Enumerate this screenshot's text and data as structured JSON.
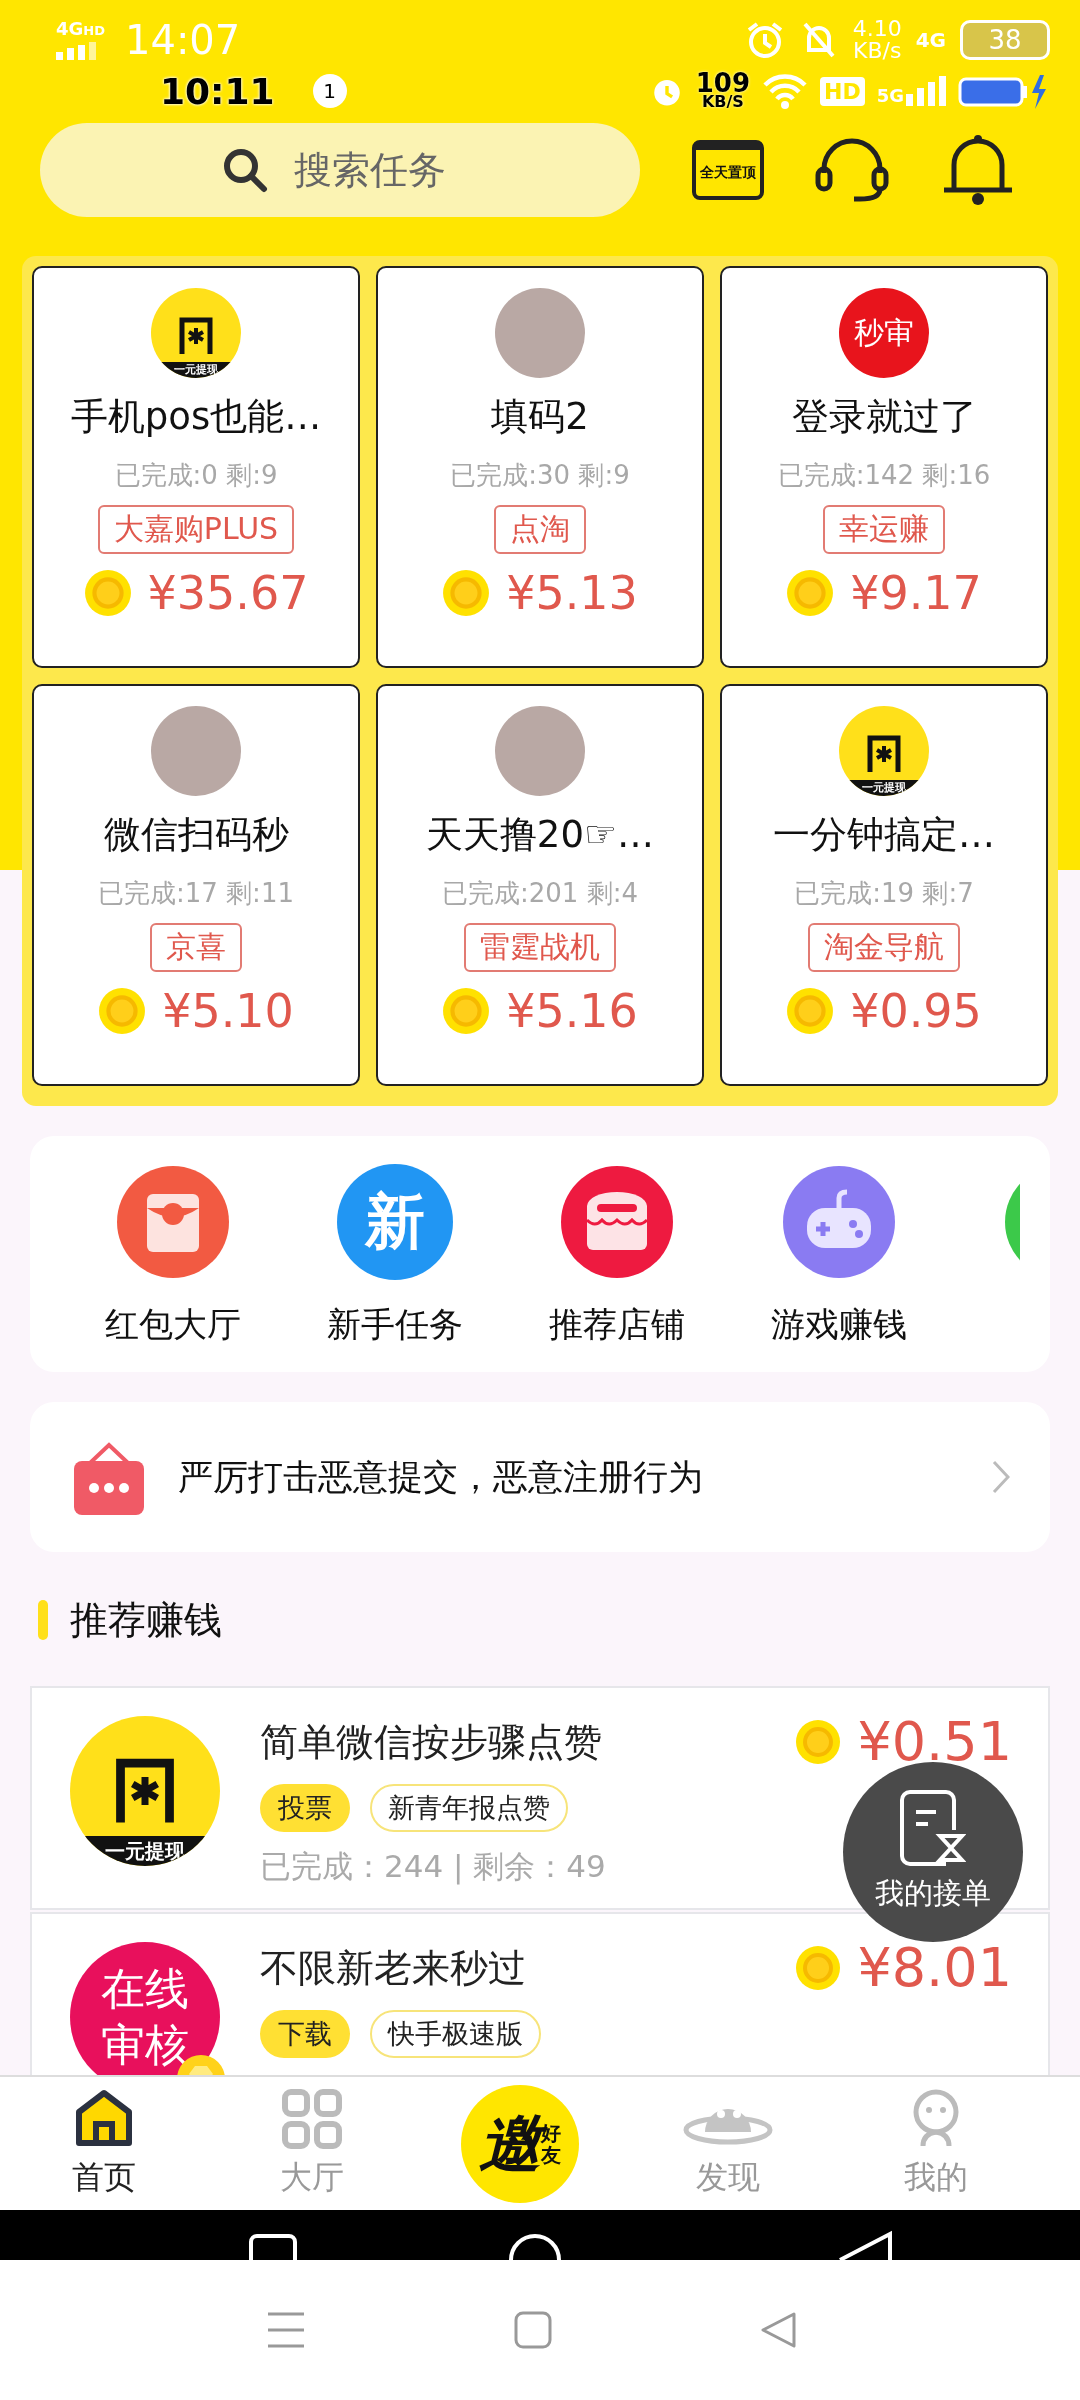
{
  "status_bar_back": {
    "network": "4G",
    "network_hd": "HD",
    "time": "14:07",
    "speed": "4.10",
    "speed_unit": "KB/s",
    "network_right": "4G",
    "battery": "38"
  },
  "status_bar": {
    "time": "10:11",
    "notifications": "1",
    "speed": "109",
    "speed_unit": "KB/S",
    "hd": "HD",
    "network": "5G"
  },
  "search": {
    "placeholder": "搜索任务"
  },
  "pin_button": {
    "label": "全天置顶"
  },
  "featured_tasks": [
    {
      "kind": "logo",
      "avatar_text": "一元提现",
      "title": "手机pos也能…",
      "stats": "已完成:0 剩:9",
      "tag": "大嘉购PLUS",
      "price": "¥35.67"
    },
    {
      "kind": "photo",
      "title": "填码2",
      "stats": "已完成:30 剩:9",
      "tag": "点淘",
      "price": "¥5.13"
    },
    {
      "kind": "text",
      "avatar_text": "秒审",
      "title": "登录就过了",
      "stats": "已完成:142 剩:16",
      "tag": "幸运赚",
      "price": "¥9.17"
    },
    {
      "kind": "photo",
      "title": "微信扫码秒",
      "stats": "已完成:17 剩:11",
      "tag": "京喜",
      "price": "¥5.10"
    },
    {
      "kind": "photo",
      "title": "天天撸20☞…",
      "stats": "已完成:201 剩:4",
      "tag": "雷霆战机",
      "price": "¥5.16"
    },
    {
      "kind": "logo",
      "avatar_text": "一元提现",
      "title": "一分钟搞定…",
      "stats": "已完成:19 剩:7",
      "tag": "淘金导航",
      "price": "¥0.95"
    }
  ],
  "shortcuts": [
    {
      "kind": "envelope",
      "label": "红包大厅"
    },
    {
      "kind": "text",
      "icon_text": "新",
      "label": "新手任务"
    },
    {
      "kind": "store",
      "label": "推荐店铺"
    },
    {
      "kind": "gamepad",
      "label": "游戏赚钱"
    }
  ],
  "notice": {
    "text": "严厉打击恶意提交，恶意注册行为"
  },
  "section_title": "推荐赚钱",
  "tasks": [
    {
      "kind": "logo",
      "avatar_text": "一元提现",
      "title": "简单微信按步骤点赞",
      "tags": [
        {
          "label": "投票",
          "kind": "filled"
        },
        {
          "label": "新青年报点赞",
          "kind": "outline"
        }
      ],
      "stats": "已完成：244 | 剩余：49",
      "price": "¥0.51"
    },
    {
      "kind": "text",
      "avatar_text": "在线审核",
      "badge": true,
      "title": "不限新老来秒过",
      "tags": [
        {
          "label": "下载",
          "kind": "filled"
        },
        {
          "label": "快手极速版",
          "kind": "outline"
        }
      ],
      "price": "¥8.01"
    }
  ],
  "floating_button": {
    "label": "我的接单"
  },
  "invite_button": {
    "main": "邀",
    "sub": "好友"
  },
  "nav_tabs": [
    {
      "kind": "home",
      "label": "首页",
      "selected": true
    },
    {
      "kind": "grid",
      "label": "大厅",
      "selected": false
    },
    {
      "kind": "ghost",
      "label": "发现",
      "selected": false
    },
    {
      "kind": "person",
      "label": "我的",
      "selected": false
    }
  ]
}
